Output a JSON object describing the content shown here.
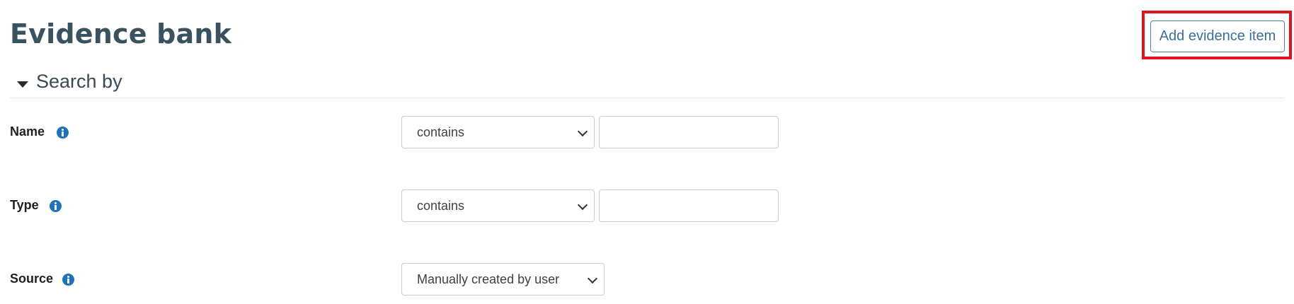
{
  "page": {
    "title": "Evidence bank",
    "add_button_label": "Add evidence item",
    "highlight_color": "#e0141e"
  },
  "section": {
    "title": "Search by",
    "toggle_icon": "caret-down-icon"
  },
  "filters": [
    {
      "label": "Name",
      "help_icon": "info-circle-icon",
      "operator": "contains",
      "value": ""
    },
    {
      "label": "Type",
      "help_icon": "info-circle-icon",
      "operator": "contains",
      "value": ""
    },
    {
      "label": "Source",
      "help_icon": "info-circle-icon",
      "operator": "Manually created by user"
    }
  ]
}
